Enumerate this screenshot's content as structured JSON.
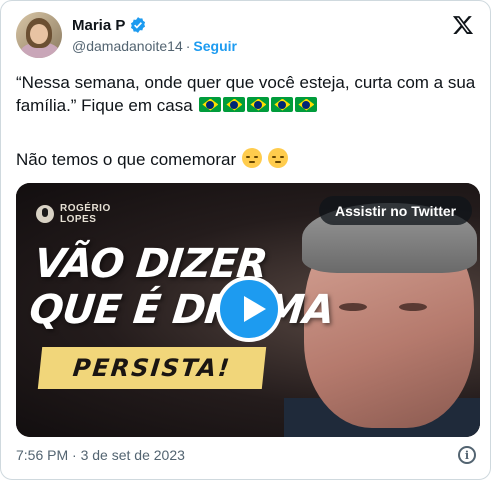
{
  "tweet": {
    "author_name": "Maria P",
    "handle": "@damadanoite14",
    "separator": "·",
    "follow_label": "Seguir",
    "text_line1": "“Nessa semana, onde quer que você esteja, curta com a sua família.”  Fique em casa",
    "text_line2": "Não temos o que comemorar",
    "flags_count": 5,
    "timestamp": "7:56 PM · 3 de set de 2023"
  },
  "media": {
    "brand_line1": "ROGÉRIO",
    "brand_line2": "LOPES",
    "headline_line1": "VÃO DIZER",
    "headline_line2": "QUE É DRAMA",
    "banner": "PERSISTA!",
    "watch_label": "Assistir no Twitter"
  },
  "icons": {
    "verified": "verified-badge-icon",
    "logo": "x-logo-icon",
    "play": "play-icon",
    "info": "info-icon",
    "flag": "brazil-flag-emoji",
    "emoji1": "relieved-face-emoji",
    "emoji2": "disappointed-face-emoji"
  },
  "colors": {
    "accent": "#1d9bf0",
    "text": "#0f1419",
    "muted": "#536471",
    "banner": "#f1d67a"
  }
}
